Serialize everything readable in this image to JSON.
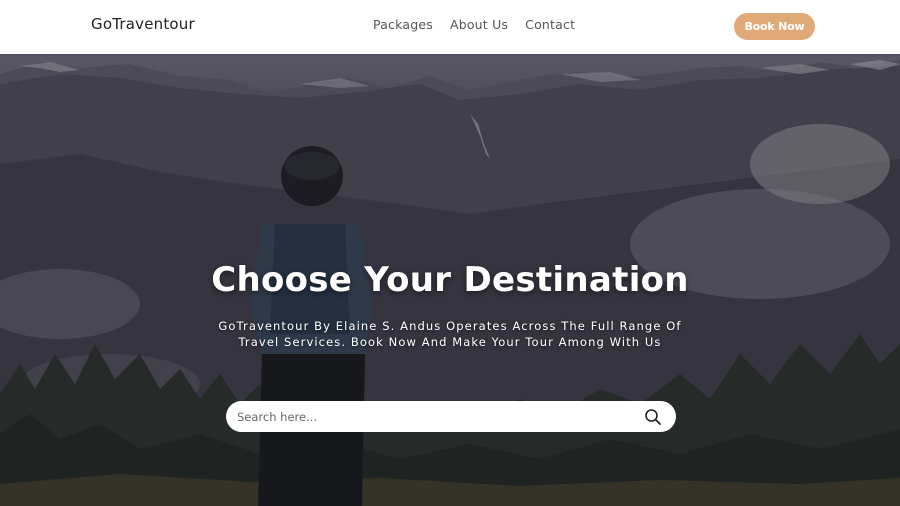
{
  "nav": {
    "brand": "GoTraventour",
    "links": [
      "Packages",
      "About Us",
      "Contact"
    ],
    "cta_label": "Book Now"
  },
  "hero": {
    "title": "Choose Your Destination",
    "subtitle": "GoTraventour By Elaine S. Andus Operates Across The Full Range Of Travel Services. Book Now And Make Your Tour Among With Us",
    "search_placeholder": "Search here..."
  },
  "icons": {
    "search": "search-icon"
  },
  "colors": {
    "accent": "#e0aa78",
    "navbar_bg": "#ffffff",
    "hero_text": "#ffffff"
  }
}
